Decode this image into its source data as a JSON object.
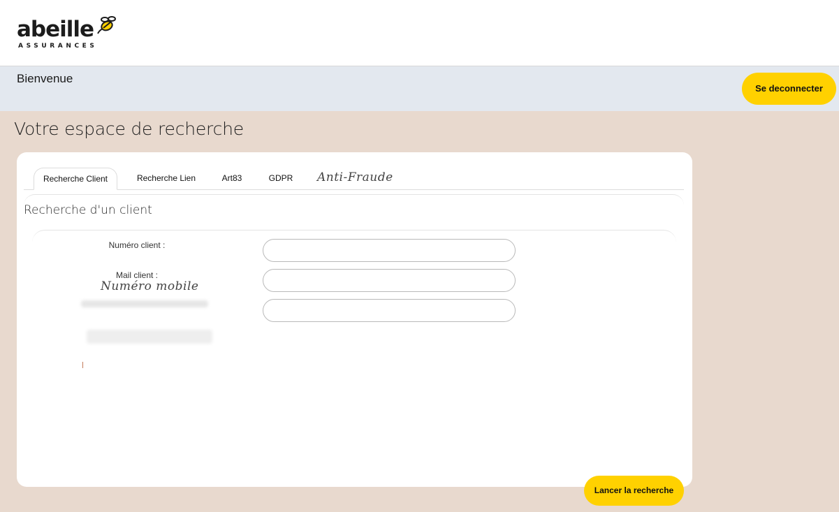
{
  "brand": {
    "name": "abeille",
    "tagline": "ASSURANCES",
    "icon": "bee-icon"
  },
  "header": {
    "welcome": "Bienvenue",
    "logout_label": "Se deconnecter"
  },
  "page": {
    "title": "Votre espace de recherche"
  },
  "tabs": [
    {
      "label": "Recherche Client",
      "active": true
    },
    {
      "label": "Recherche Lien",
      "active": false
    },
    {
      "label": "Art83",
      "active": false
    },
    {
      "label": "GDPR",
      "active": false
    }
  ],
  "annotations": {
    "tab_note": "Anti-Fraude",
    "field_note": "Numéro mobile"
  },
  "form": {
    "title": "Recherche d'un client",
    "fields": [
      {
        "label": "Numéro client :",
        "value": ""
      },
      {
        "label": "Mail client :",
        "value": ""
      },
      {
        "label": "",
        "value": ""
      }
    ],
    "submit_label": "Lancer la recherche"
  },
  "colors": {
    "accent": "#ffd100",
    "page_bg": "#e8d9ce",
    "welcome_bg": "#e3e8ef"
  }
}
